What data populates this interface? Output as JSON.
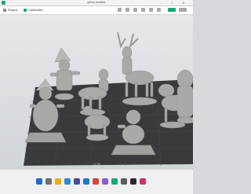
{
  "window": {
    "title": "yukon-reindeer",
    "minimize_glyph": "–",
    "maximize_glyph": "□",
    "close_glyph": "✕"
  },
  "tabs": [
    {
      "label": "Project",
      "icon": "folder-icon"
    },
    {
      "label": "Calibration",
      "icon": "calibration-icon"
    }
  ],
  "plate": {
    "label": "☐ 1/1"
  },
  "taskbar": {
    "apps": [
      "start-icon",
      "search-icon",
      "files-icon",
      "browser-icon",
      "store-icon",
      "mail-icon",
      "chrome-icon",
      "photos-icon",
      "slicer-icon",
      "settings-icon",
      "terminal-icon",
      "music-icon"
    ],
    "time": "",
    "date": ""
  },
  "colors": {
    "accent": "#19a974",
    "plate": "#3a3a3c",
    "model": "#a8aaa8"
  }
}
